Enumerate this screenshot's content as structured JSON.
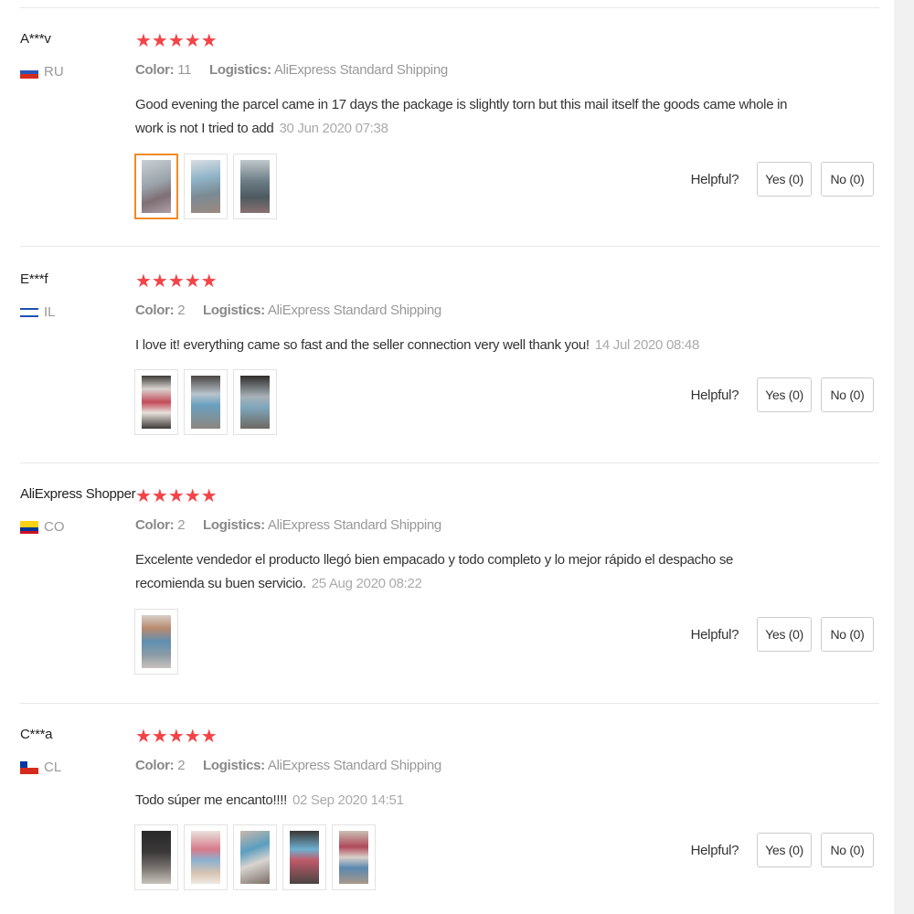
{
  "labels": {
    "color": "Color:",
    "logistics": "Logistics:",
    "helpful": "Helpful?"
  },
  "reviews": [
    {
      "user": "A***v",
      "country": "RU",
      "stars": "★★★★★",
      "color_value": "11",
      "logistics_value": "AliExpress Standard Shipping",
      "text": "Good evening the parcel came in 17 days the package is slightly torn but this mail itself the goods came whole in work is not I tried to add",
      "date": "30 Jun 2020 07:38",
      "yes": "Yes (0)",
      "no": "No (0)",
      "flag_colors": [
        "#ffffff",
        "#2b56b8",
        "#d52b1e"
      ],
      "photos": 3
    },
    {
      "user": "E***f",
      "country": "IL",
      "stars": "★★★★★",
      "color_value": "2",
      "logistics_value": "AliExpress Standard Shipping",
      "text": "I love it! everything came so fast and the seller connection very well thank you!",
      "date": "14 Jul 2020 08:48",
      "yes": "Yes (0)",
      "no": "No (0)",
      "flag_colors": [
        "#ffffff",
        "#1f4fb5",
        "#ffffff"
      ],
      "photos": 3
    },
    {
      "user": "AliExpress Shopper",
      "country": "CO",
      "stars": "★★★★★",
      "color_value": "2",
      "logistics_value": "AliExpress Standard Shipping",
      "text": "Excelente vendedor el producto llegó bien empacado y todo completo y lo mejor rápido el despacho se recomienda su buen servicio.",
      "date": "25 Aug 2020 08:22",
      "yes": "Yes (0)",
      "no": "No (0)",
      "flag_colors": [
        "#fcd116",
        "#003893",
        "#ce1126"
      ],
      "photos": 1
    },
    {
      "user": "C***a",
      "country": "CL",
      "stars": "★★★★★",
      "color_value": "2",
      "logistics_value": "AliExpress Standard Shipping",
      "text": "Todo súper me encanto!!!!",
      "date": "02 Sep 2020 14:51",
      "yes": "Yes (0)",
      "no": "No (0)",
      "flag_colors": [
        "#ffffff",
        "#d52b1e",
        "#0039a6"
      ],
      "photos": 5
    }
  ]
}
